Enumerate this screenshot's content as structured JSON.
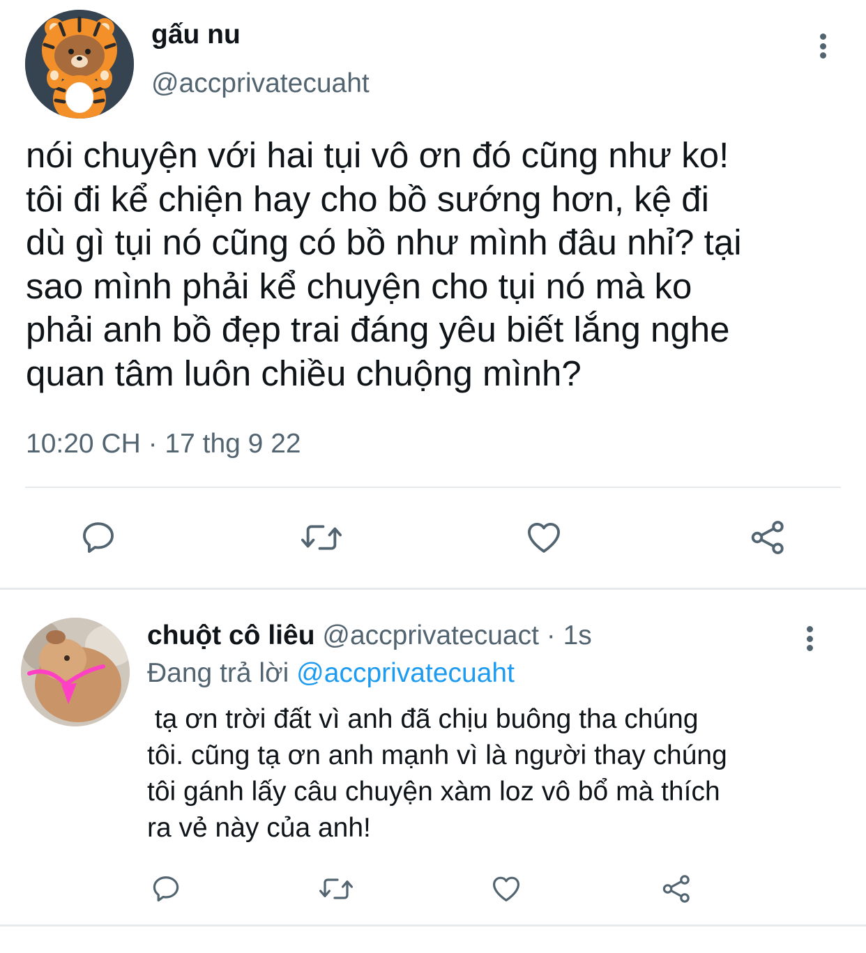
{
  "main_tweet": {
    "display_name": "gấu nu",
    "handle": "@accprivatecuaht",
    "text_lines": [
      "nói chuyện với hai tụi vô ơn đó cũng như ko!",
      "tôi đi kể chiện hay cho bồ sướng hơn, kệ đi",
      "dù gì tụi nó cũng có bồ như mình đâu nhỉ? tại",
      "sao mình phải kể chuyện cho tụi nó mà ko",
      "phải anh bồ đẹp trai đáng yêu biết lắng nghe",
      "quan tâm luôn chiều chuộng mình?"
    ],
    "timestamp": "10:20 CH · 17 thg 9 22",
    "actions": [
      "reply-icon",
      "retweet-icon",
      "like-icon",
      "share-icon"
    ]
  },
  "reply_tweet": {
    "display_name": "chuột cô liêu",
    "handle": "@accprivatecuact",
    "time_ago": "· 1s",
    "replying_to_label": "Đang trả lời",
    "replying_to_handle": "@accprivatecuaht",
    "text_lines": [
      " tạ ơn trời đất vì anh đã chịu buông tha chúng",
      "tôi. cũng tạ ơn anh mạnh vì là người thay chúng",
      "tôi gánh lấy câu chuyện xàm loz vô bổ mà thích",
      "ra vẻ này của anh!"
    ],
    "actions": [
      "reply-icon",
      "retweet-icon",
      "like-icon",
      "share-icon"
    ]
  },
  "colors": {
    "text": "#0f1419",
    "secondary": "#536471",
    "link": "#1d9bf0",
    "divider": "#e6eaed",
    "avatar_bg": "#364452"
  }
}
